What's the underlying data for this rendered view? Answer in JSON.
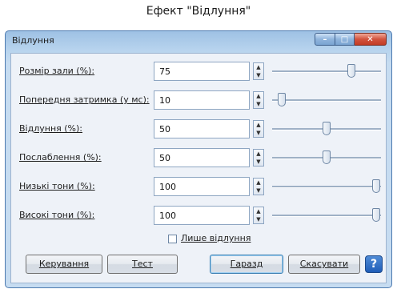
{
  "caption": "Ефект \"Відлуння\"",
  "window": {
    "title": "Відлуння",
    "controls": {
      "minimize": "–",
      "maximize": "□",
      "close": "✕"
    }
  },
  "rows": [
    {
      "label": "Розмір зали (%):",
      "value": "75",
      "slider_fraction": 0.75
    },
    {
      "label": "Попередня затримка (у мс):",
      "value": "10",
      "slider_fraction": 0.05
    },
    {
      "label": "Відлуння (%):",
      "value": "50",
      "slider_fraction": 0.5
    },
    {
      "label": "Послаблення (%):",
      "value": "50",
      "slider_fraction": 0.5
    },
    {
      "label": "Низькі тони (%):",
      "value": "100",
      "slider_fraction": 1.0
    },
    {
      "label": "Високі тони (%):",
      "value": "100",
      "slider_fraction": 1.0
    }
  ],
  "options": {
    "only_echo_label": "Лише відлуння",
    "only_echo_checked": false
  },
  "buttons": {
    "controls": "Керування",
    "test": "Тест",
    "ok": "Гаразд",
    "cancel": "Скасувати",
    "help": "?"
  }
}
